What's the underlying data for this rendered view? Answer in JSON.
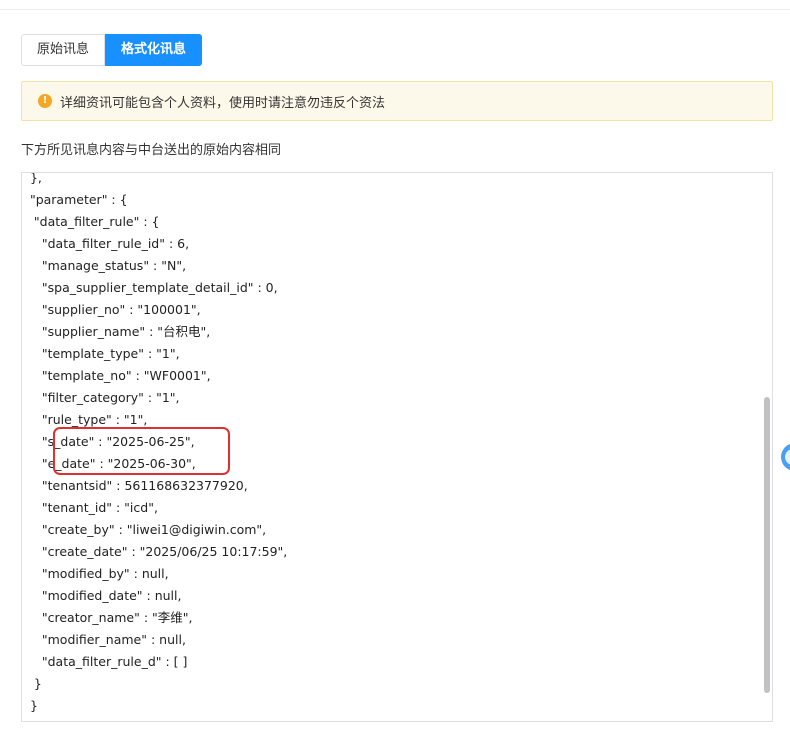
{
  "tabs": [
    {
      "label": "原始讯息",
      "active": false
    },
    {
      "label": "格式化讯息",
      "active": true
    }
  ],
  "warning": {
    "icon": "warning-icon",
    "text": "详细资讯可能包含个人资料，使用时请注意勿违反个资法",
    "color": "#f5a623"
  },
  "info_text": "下方所见讯息内容与中台送出的原始内容相同",
  "code_lines": [
    "  },",
    "  \"parameter\" : {",
    "   \"data_filter_rule\" : {",
    "     \"data_filter_rule_id\" : 6,",
    "     \"manage_status\" : \"N\",",
    "     \"spa_supplier_template_detail_id\" : 0,",
    "     \"supplier_no\" : \"100001\",",
    "     \"supplier_name\" : \"台积电\",",
    "     \"template_type\" : \"1\",",
    "     \"template_no\" : \"WF0001\",",
    "     \"filter_category\" : \"1\",",
    "     \"rule_type\" : \"1\",",
    "     \"s_date\" : \"2025-06-25\",",
    "     \"e_date\" : \"2025-06-30\",",
    "     \"tenantsid\" : 561168632377920,",
    "     \"tenant_id\" : \"icd\",",
    "     \"create_by\" : \"liwei1@digiwin.com\",",
    "     \"create_date\" : \"2025/06/25 10:17:59\",",
    "     \"modified_by\" : null,",
    "     \"modified_date\" : null,",
    "     \"creator_name\" : \"李维\",",
    "     \"modifier_name\" : null,",
    "     \"data_filter_rule_d\" : [ ]",
    "   }",
    "  }"
  ],
  "colors": {
    "accent": "#1890ff",
    "highlight_border": "#e0312f"
  }
}
